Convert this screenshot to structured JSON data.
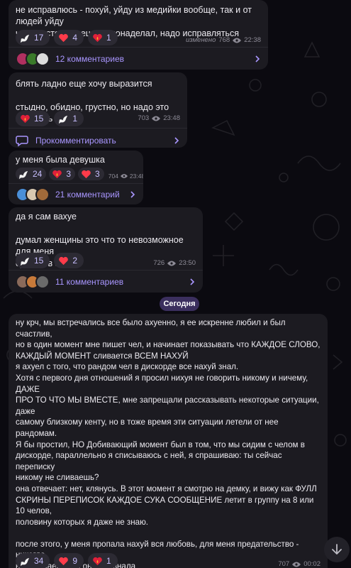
{
  "date_divider": "Сегодня",
  "posts": [
    {
      "text": "не исправлюсь - похуй, уйду из медийки вообще, так и от людей уйду\nчот просто пиздец дел понаделал, надо исправляться",
      "reactions": [
        {
          "icon": "dove-icon",
          "count": "17"
        },
        {
          "icon": "heart-icon",
          "count": "4"
        },
        {
          "icon": "heart-fire-icon",
          "count": "1"
        }
      ],
      "edited": "изменено",
      "views": "768",
      "time": "22:38",
      "comments": "12 комментариев"
    },
    {
      "text": "блять ладно еще хочу выразится\n\nстыдно, обидно, грустно, но надо это признать",
      "reactions": [
        {
          "icon": "heart-fire-icon",
          "count": "15"
        },
        {
          "icon": "dove-icon",
          "count": "1"
        }
      ],
      "views": "703",
      "time": "23:48",
      "comments": "Прокомментировать"
    },
    {
      "text": "у меня была девушка",
      "reactions": [
        {
          "icon": "dove-icon",
          "count": "24"
        },
        {
          "icon": "heart-fire-icon",
          "count": "3"
        },
        {
          "icon": "heart-icon",
          "count": "3"
        }
      ],
      "views": "704",
      "time": "23:48",
      "comments": "21 комментарий"
    },
    {
      "text": "да я сам вахуе\n\nдумал женщины это что то невозможное для меня\nсуть не в этом",
      "reactions": [
        {
          "icon": "dove-icon",
          "count": "15"
        },
        {
          "icon": "heart-icon",
          "count": "2"
        }
      ],
      "views": "726",
      "time": "23:50",
      "comments": "11 комментариев"
    },
    {
      "text": "ну крч, мы встречались все было ахуенно, я ее искренне любил и был счастлив,\nно в один момент мне пишет чел, и начинает показывать что КАЖДОЕ СЛОВО,\nКАЖДЫЙ МОМЕНТ сливается ВСЕМ НАХУЙ\nя ахуел с того, что рандом чел в дискорде все нахуй знал.\nХотя с первого дня отношений я просил нихуя не говорить никому и ничему, ДАЖЕ\nПРО ТО ЧТО МЫ ВМЕСТЕ, мне запрещали рассказывать некоторые ситуации, даже\nсамому близкому кенту, но в тоже время эти ситуации летели от нее рандомам.\nЯ бы простил, НО Добивающий момент был в том, что мы сидим с челом в\nдискорде, параллельно я списываюсь с ней, я спрашиваю: ты сейчас переписку\nникому не сливаешь?\nона отвечает: нет, клянусь. В этот момент я смотрю на демку, и вижу как ФУЛЛ\nСКРИНЫ ПЕРЕПИСОК КАЖДОЕ СУКА СООБЩЕНИЕ летит в группу на 8 или 10 челов,\nполовину которых я даже не знаю.\n\nпосле этого, у меня пропала нахуй вся любовь, для меня предательство - никогда\nне прощаемое, и она это знала\nв итоге я настаивал на расставание, но в меня летели \"нет, прости пожалуйста, нет\",\nв итоге мне стало ее жалко и мы согласились на паузу\nменя пиздец мучало то, что я просыпался и засыпал с мыслью, бля меня предал\nчеловек, которому я доверял все секреты и т.д.,\nименно поэтому я в апреле почти не стримил нихуя\n\nпродолжение в  некст посте",
      "reactions": [
        {
          "icon": "dove-icon",
          "count": "34"
        },
        {
          "icon": "heart-icon",
          "count": "9"
        },
        {
          "icon": "heart-fire-icon",
          "count": "1"
        }
      ],
      "views": "707",
      "time": "00:02"
    }
  ]
}
